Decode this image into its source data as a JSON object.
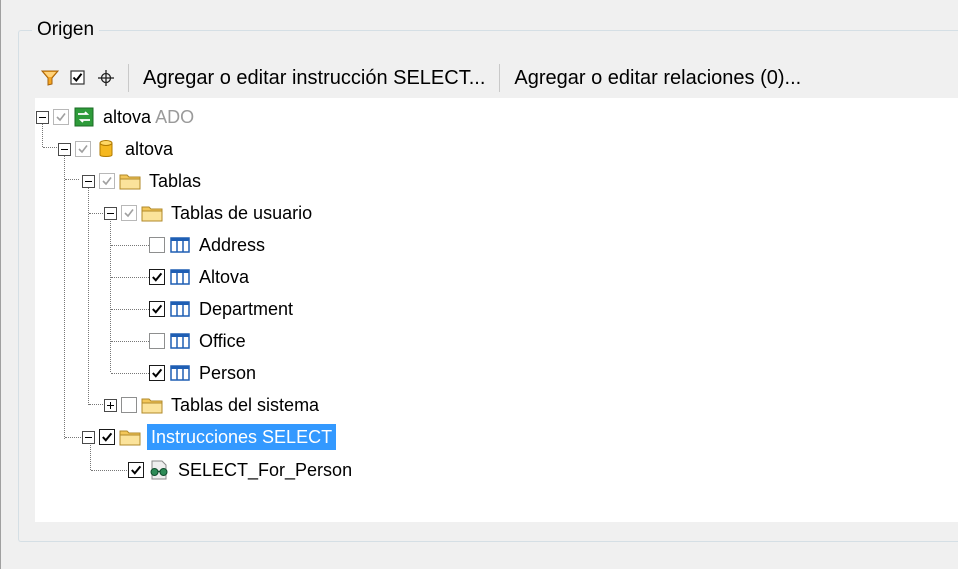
{
  "group": {
    "title": "Origen"
  },
  "toolbar": {
    "filter_icon": "filter-icon",
    "check_icon": "checkbox-icon",
    "locate_icon": "crosshair-icon",
    "select_button": "Agregar o editar instrucción SELECT...",
    "relations_button": "Agregar o editar relaciones (0)..."
  },
  "tree": {
    "root": {
      "label": "altova",
      "suffix": "ADO",
      "checked": true,
      "enabled": false
    },
    "database": {
      "label": "altova",
      "checked": true,
      "enabled": false
    },
    "tables": {
      "label": "Tablas",
      "checked": true,
      "enabled": false
    },
    "user_tables": {
      "label": "Tablas de usuario",
      "checked": true,
      "enabled": false
    },
    "user_table_items": [
      {
        "label": "Address",
        "checked": false
      },
      {
        "label": "Altova",
        "checked": true
      },
      {
        "label": "Department",
        "checked": true
      },
      {
        "label": "Office",
        "checked": false
      },
      {
        "label": "Person",
        "checked": true
      }
    ],
    "system_tables": {
      "label": "Tablas del sistema",
      "checked": false
    },
    "select_statements": {
      "label": "Instrucciones SELECT",
      "checked": true,
      "selected": true
    },
    "select_items": [
      {
        "label": "SELECT_For_Person",
        "checked": true
      }
    ]
  },
  "colors": {
    "selection": "#3399ff",
    "folder": "#f3c75a",
    "table_icon": "#1f5fb4",
    "ado_icon": "#2e9b3a"
  }
}
